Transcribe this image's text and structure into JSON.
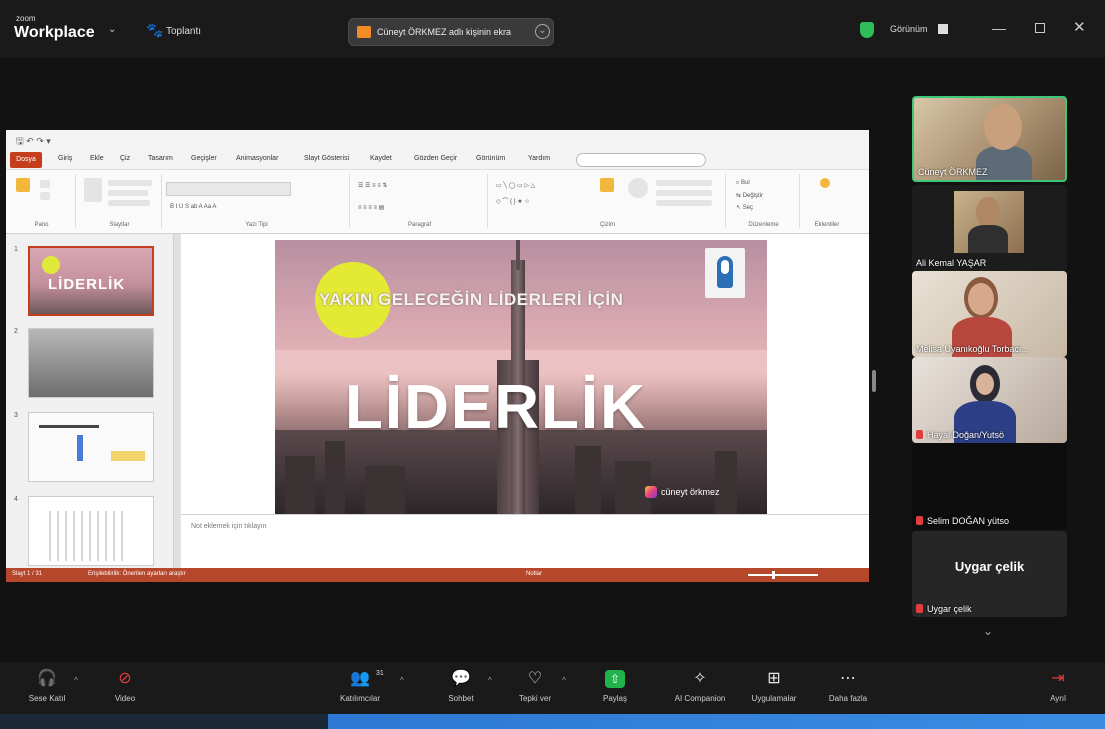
{
  "app": {
    "brand_small": "zoom",
    "brand": "Workplace",
    "meeting_label": "Toplantı",
    "share_banner": "Cüneyt ÖRKMEZ adlı kişinin ekra",
    "view_label": "Görünüm",
    "accent": "#2ebd59"
  },
  "powerpoint": {
    "tabs": [
      "Dosya",
      "Giriş",
      "Ekle",
      "Çiz",
      "Tasarım",
      "Geçişler",
      "Animasyonlar",
      "Slayt Gösterisi",
      "Kaydet",
      "Gözden Geçir",
      "Görünüm",
      "Yardım"
    ],
    "ribbon_groups": [
      "Pano",
      "Slaytlar",
      "Yazı Tipi",
      "Paragraf",
      "Çizim",
      "Düzenleme",
      "Eklentiler"
    ],
    "notes_placeholder": "Not eklemek için tıklayın",
    "status_left": "Slayt 1 / 31",
    "status_left2": "Erişilebilirlik: Önerilen ayarları araştır",
    "status_right": "Notlar",
    "slide": {
      "subtitle": "YAKIN GELECEĞİN LİDERLERİ İÇİN",
      "title": "LİDERLİK",
      "footer": "cüneyt örkmez"
    },
    "thumbnails": [
      {
        "num": "1",
        "label": "LİDERLİK"
      },
      {
        "num": "2",
        "label": ""
      },
      {
        "num": "3",
        "label": ""
      },
      {
        "num": "4",
        "label": ""
      }
    ]
  },
  "participants": [
    {
      "name": "Cüneyt ÖRKMEZ",
      "muted": false
    },
    {
      "name": "Ali Kemal YAŞAR",
      "muted": false
    },
    {
      "name": "Melisa Uyanıkoğlu Torbacı...",
      "muted": false
    },
    {
      "name": "Hayal Doğan/Yutsö",
      "muted": true
    },
    {
      "name": "Selim DOĞAN yütso",
      "muted": true
    },
    {
      "name": "Uygar çelik",
      "muted": true,
      "display": "Uygar çelik"
    }
  ],
  "toolbar": {
    "audio": "Sese Katıl",
    "video": "Video",
    "participants": "Katılımcılar",
    "participant_count": "31",
    "chat": "Sohbet",
    "react": "Tepki ver",
    "share": "Paylaş",
    "ai": "AI Companion",
    "apps": "Uygulamalar",
    "more": "Daha fazla",
    "leave": "Ayrıl"
  }
}
